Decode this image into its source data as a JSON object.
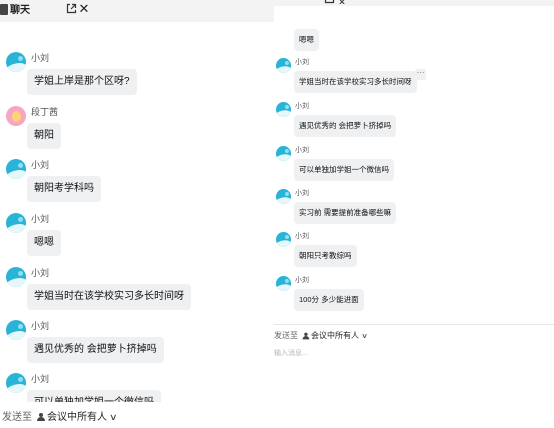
{
  "left_window": {
    "title": "聊天",
    "messages": [
      {
        "sender": "小刘",
        "text": "学姐上岸是那个区呀?"
      },
      {
        "sender": "段丁茜",
        "text": "朝阳"
      },
      {
        "sender": "小刘",
        "text": "朝阳考学科吗"
      },
      {
        "sender": "小刘",
        "text": "嗯嗯"
      },
      {
        "sender": "小刘",
        "text": "学姐当时在该学校实习多长时间呀"
      },
      {
        "sender": "小刘",
        "text": "遇见优秀的 会把萝卜挤掉吗"
      },
      {
        "sender": "小刘",
        "text": "可以单独加学姐一个微信吗"
      }
    ],
    "footer": {
      "send_to_label": "发送至",
      "recipient": "会议中所有人"
    }
  },
  "right_window": {
    "messages": [
      {
        "sender": "",
        "text": "嗯嗯"
      },
      {
        "sender": "小刘",
        "text": "学姐当时在该学校实习多长时间呀"
      },
      {
        "sender": "小刘",
        "text": "遇见优秀的 会把萝卜挤掉吗"
      },
      {
        "sender": "小刘",
        "text": "可以单独加学姐一个微信吗"
      },
      {
        "sender": "小刘",
        "text": "实习前 需要提前准备哪些嘛"
      },
      {
        "sender": "小刘",
        "text": "朝阳只考教综吗"
      },
      {
        "sender": "小刘",
        "text": "100分  多少能进面"
      }
    ],
    "footer": {
      "send_to_label": "发送至",
      "recipient": "会议中所有人"
    },
    "input_placeholder": "输入消息..."
  },
  "icons": {
    "avatar": "avatar-icon",
    "chat_tab": "chat-tab-icon",
    "popout": "popout-icon",
    "close": "close-icon",
    "more": "more-options-icon",
    "person": "person-icon",
    "dropdown": "chevron-down-icon"
  },
  "colors": {
    "bubble": "#eef0f2",
    "avatar_blue": "#29b3d6",
    "avatar_pink": "#f6a6c2"
  }
}
